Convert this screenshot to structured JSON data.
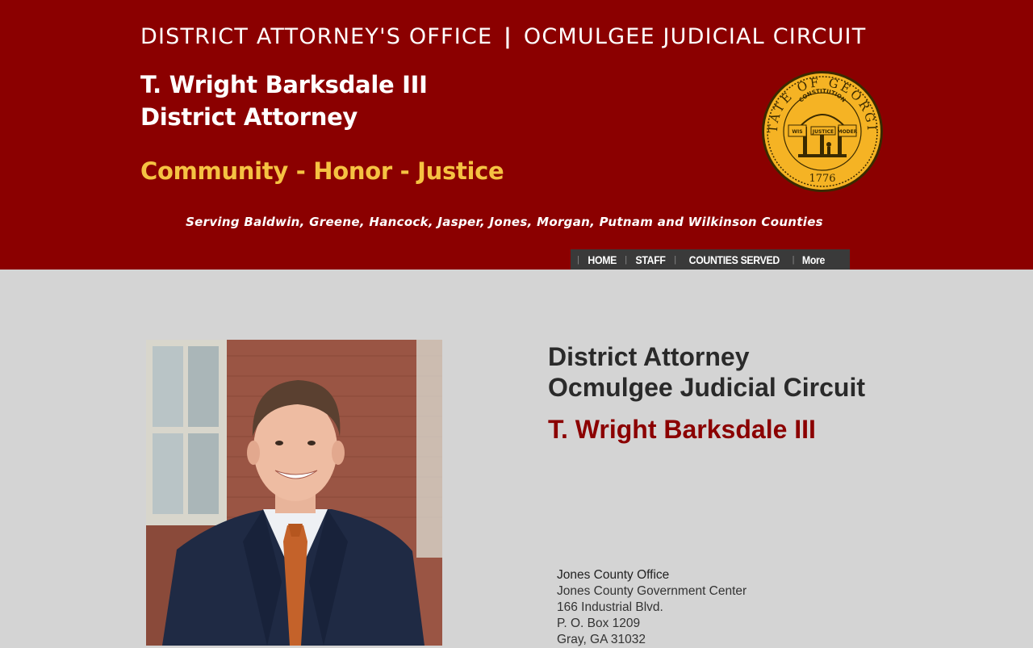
{
  "header": {
    "office_left": "DISTRICT ATTORNEY'S OFFICE",
    "office_sep": "|",
    "office_right": "OCMULGEE JUDICIAL CIRCUIT",
    "da_name": "T. Wright Barksdale III",
    "da_role": "District Attorney",
    "motto": "Community - Honor - Justice",
    "serving": "Serving Baldwin, Greene, Hancock, Jasper, Jones, Morgan, Putnam and Wilkinson Counties",
    "seal": {
      "outer_text": "STATE OF GEORGIA",
      "arch_text": "CONSTITUTION",
      "banner_left": "WISDOM",
      "banner_center": "JUSTICE",
      "banner_right": "MODERATION",
      "year": "1776",
      "colors": {
        "gold": "#f5b324",
        "dark": "#3a2a00"
      }
    }
  },
  "nav": {
    "items": [
      "HOME",
      "STAFF",
      "COUNTIES SERVED",
      "More"
    ],
    "divider": "|"
  },
  "main": {
    "title_line1": "District Attorney",
    "title_line2": "Ocmulgee Judicial Circuit",
    "name": "T. Wright Barksdale III",
    "address": {
      "heading": "Jones County Office",
      "line1": "Jones County Government Center",
      "line2": "166 Industrial Blvd.",
      "line3": "P. O. Box 1209",
      "line4": "Gray, GA 31032"
    }
  },
  "colors": {
    "header_bg": "#8b0000",
    "body_bg": "#d4d4d4",
    "motto": "#f5c242",
    "nav_bg": "#3a3a3a",
    "accent_name": "#8b0000"
  }
}
